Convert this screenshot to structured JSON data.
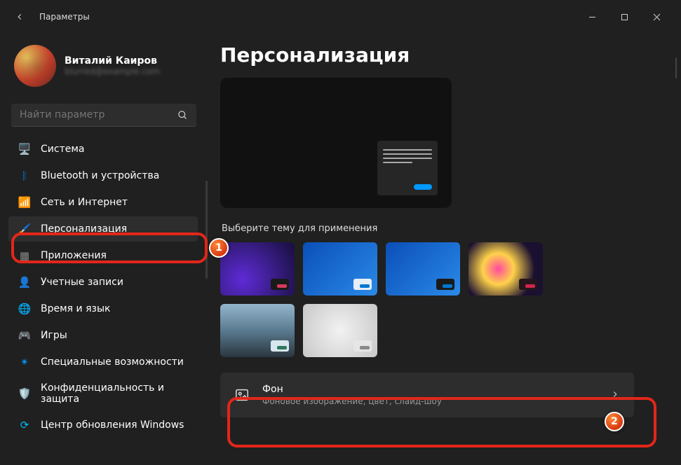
{
  "app": {
    "title": "Параметры"
  },
  "profile": {
    "name": "Виталий Каиров",
    "email": "blurred@example.com"
  },
  "search": {
    "placeholder": "Найти параметр"
  },
  "sidebar": {
    "items": [
      {
        "label": "Система",
        "icon": "🖥️",
        "color": "#0078d4"
      },
      {
        "label": "Bluetooth и устройства",
        "icon": "ᛒ",
        "color": "#0078d4"
      },
      {
        "label": "Сеть и Интернет",
        "icon": "📶",
        "color": "#00bcf2"
      },
      {
        "label": "Персонализация",
        "icon": "🖌️",
        "color": "#e07a2c",
        "selected": true
      },
      {
        "label": "Приложения",
        "icon": "▦",
        "color": "#888"
      },
      {
        "label": "Учетные записи",
        "icon": "👤",
        "color": "#4ad4c8"
      },
      {
        "label": "Время и язык",
        "icon": "🌐",
        "color": "#4aa0dd"
      },
      {
        "label": "Игры",
        "icon": "🎮",
        "color": "#888"
      },
      {
        "label": "Специальные возможности",
        "icon": "✴",
        "color": "#0099ff"
      },
      {
        "label": "Конфиденциальность и защита",
        "icon": "🛡️",
        "color": "#4aa0dd"
      },
      {
        "label": "Центр обновления Windows",
        "icon": "⟳",
        "color": "#00bcf2"
      }
    ]
  },
  "page": {
    "title": "Персонализация"
  },
  "themes": {
    "section_label": "Выберите тему для применения",
    "items": [
      {
        "name": "theme-1"
      },
      {
        "name": "theme-2"
      },
      {
        "name": "theme-3"
      },
      {
        "name": "theme-4"
      },
      {
        "name": "theme-5"
      },
      {
        "name": "theme-6"
      }
    ]
  },
  "settings": {
    "background": {
      "title": "Фон",
      "desc": "Фоновое изображение, цвет, слайд-шоу"
    }
  },
  "annotations": {
    "badge1": "1",
    "badge2": "2"
  }
}
